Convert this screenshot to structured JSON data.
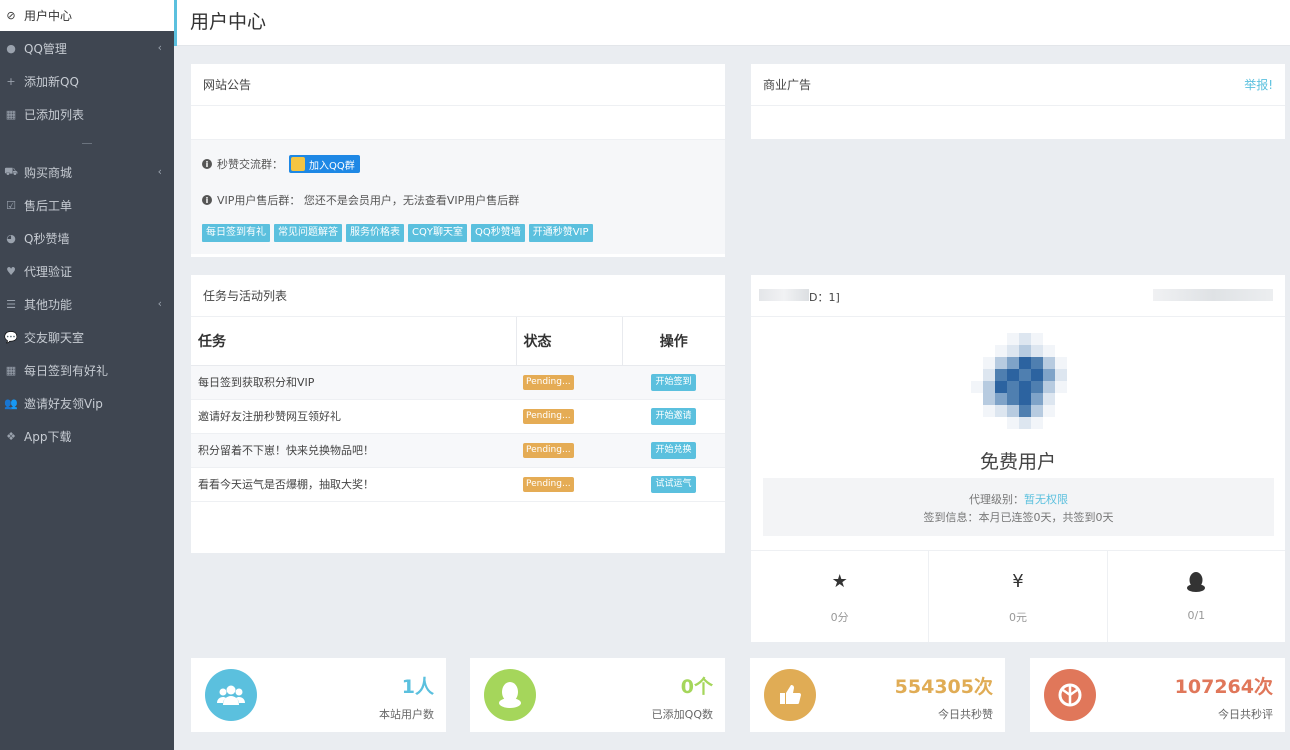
{
  "sidebar": {
    "items": [
      {
        "label": "用户中心",
        "icon": "dashboard-icon",
        "active": true
      },
      {
        "label": "QQ管理",
        "icon": "qq-icon",
        "has_arrow": true
      },
      {
        "label": "添加新QQ",
        "icon": "plus-icon"
      },
      {
        "label": "已添加列表",
        "icon": "list-icon"
      },
      {
        "label": "购买商城",
        "icon": "cart-icon",
        "has_arrow": true
      },
      {
        "label": "售后工单",
        "icon": "check-square-icon"
      },
      {
        "label": "Q秒赞墙",
        "icon": "chat-icon"
      },
      {
        "label": "代理验证",
        "icon": "heart-icon"
      },
      {
        "label": "其他功能",
        "icon": "menu-icon",
        "has_arrow": true
      },
      {
        "label": "交友聊天室",
        "icon": "comment-icon"
      },
      {
        "label": "每日签到有好礼",
        "icon": "table-icon"
      },
      {
        "label": "邀请好友领Vip",
        "icon": "users-icon"
      },
      {
        "label": "App下载",
        "icon": "app-icon"
      }
    ]
  },
  "header": {
    "title": "用户中心"
  },
  "notice": {
    "title": "网站公告",
    "group_label": "秒赞交流群：",
    "qq_button": "加入QQ群",
    "vip_text": "VIP用户售后群：  您还不是会员用户，无法查看VIP用户售后群",
    "chips": [
      "每日签到有礼",
      "常见问题解答",
      "服务价格表",
      "CQY聊天室",
      "QQ秒赞墙",
      "开通秒赞VIP"
    ]
  },
  "ad": {
    "title": "商业广告",
    "report": "举报!"
  },
  "tasks": {
    "title": "任务与活动列表",
    "columns": [
      "任务",
      "状态",
      "操作"
    ],
    "rows": [
      {
        "task": "每日签到获取积分和VIP",
        "status": "Pending...",
        "action": "开始签到"
      },
      {
        "task": "邀请好友注册秒赞网互领好礼",
        "status": "Pending...",
        "action": "开始邀请"
      },
      {
        "task": "积分留着不下崽！快来兑换物品吧！",
        "status": "Pending...",
        "action": "开始兑换"
      },
      {
        "task": "看看今天运气是否爆棚，抽取大奖！",
        "status": "Pending...",
        "action": "试试运气"
      }
    ]
  },
  "profile": {
    "uid_text": "D：1]",
    "user_type": "免费用户",
    "agent_label": "代理级别：",
    "agent_value": "暂无权限",
    "checkin": "签到信息：本月已连签0天，共签到0天",
    "stats": [
      {
        "icon": "star-icon",
        "glyph": "★",
        "value": "0分"
      },
      {
        "icon": "yen-icon",
        "glyph": "¥",
        "value": "0元"
      },
      {
        "icon": "qq-penguin-icon",
        "glyph": "",
        "value": "0/1"
      }
    ]
  },
  "cards": [
    {
      "value": "1人",
      "label": "本站用户数",
      "color": "#5bc0de",
      "icon": "users-icon"
    },
    {
      "value": "0个",
      "label": "已添加QQ数",
      "color": "#a5d65b",
      "icon": "qq-icon"
    },
    {
      "value": "554305次",
      "label": "今日共秒赞",
      "color": "#e0ac55",
      "icon": "thumbs-up-icon"
    },
    {
      "value": "107264次",
      "label": "今日共秒评",
      "color": "#e0775a",
      "icon": "rebel-icon"
    }
  ]
}
